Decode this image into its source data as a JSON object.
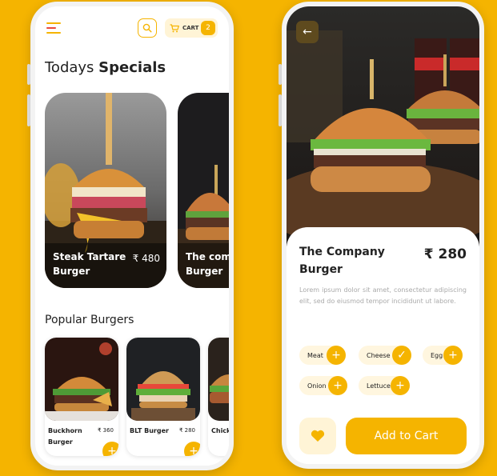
{
  "home": {
    "cart_label": "CART",
    "cart_count": "2",
    "title_plain": "Todays",
    "title_bold": "Specials",
    "specials": [
      {
        "name": "Steak Tartare Burger",
        "price": "₹ 480"
      },
      {
        "name": "The com Burger",
        "price": ""
      }
    ],
    "popular_title": "Popular Burgers",
    "popular": [
      {
        "name": "Buckhorn Burger",
        "price": "₹ 360"
      },
      {
        "name": "BLT Burger",
        "price": "₹ 280"
      },
      {
        "name": "Chick Burg",
        "price": ""
      }
    ]
  },
  "detail": {
    "name": "The Company Burger",
    "price": "₹ 280",
    "description": "Lorem ipsum dolor sit amet, consectetur adipiscing elit, sed do eiusmod tempor incididunt ut labore.",
    "ingredients": [
      {
        "label": "Meat",
        "state": "add"
      },
      {
        "label": "Cheese",
        "state": "selected"
      },
      {
        "label": "Egg",
        "state": "add"
      },
      {
        "label": "Onion",
        "state": "add"
      },
      {
        "label": "Lettuce",
        "state": "add"
      }
    ],
    "add_to_cart_label": "Add to Cart"
  },
  "colors": {
    "background": "#F5B400",
    "accent": "#F5B400",
    "accent_light": "#FFF6DF"
  }
}
